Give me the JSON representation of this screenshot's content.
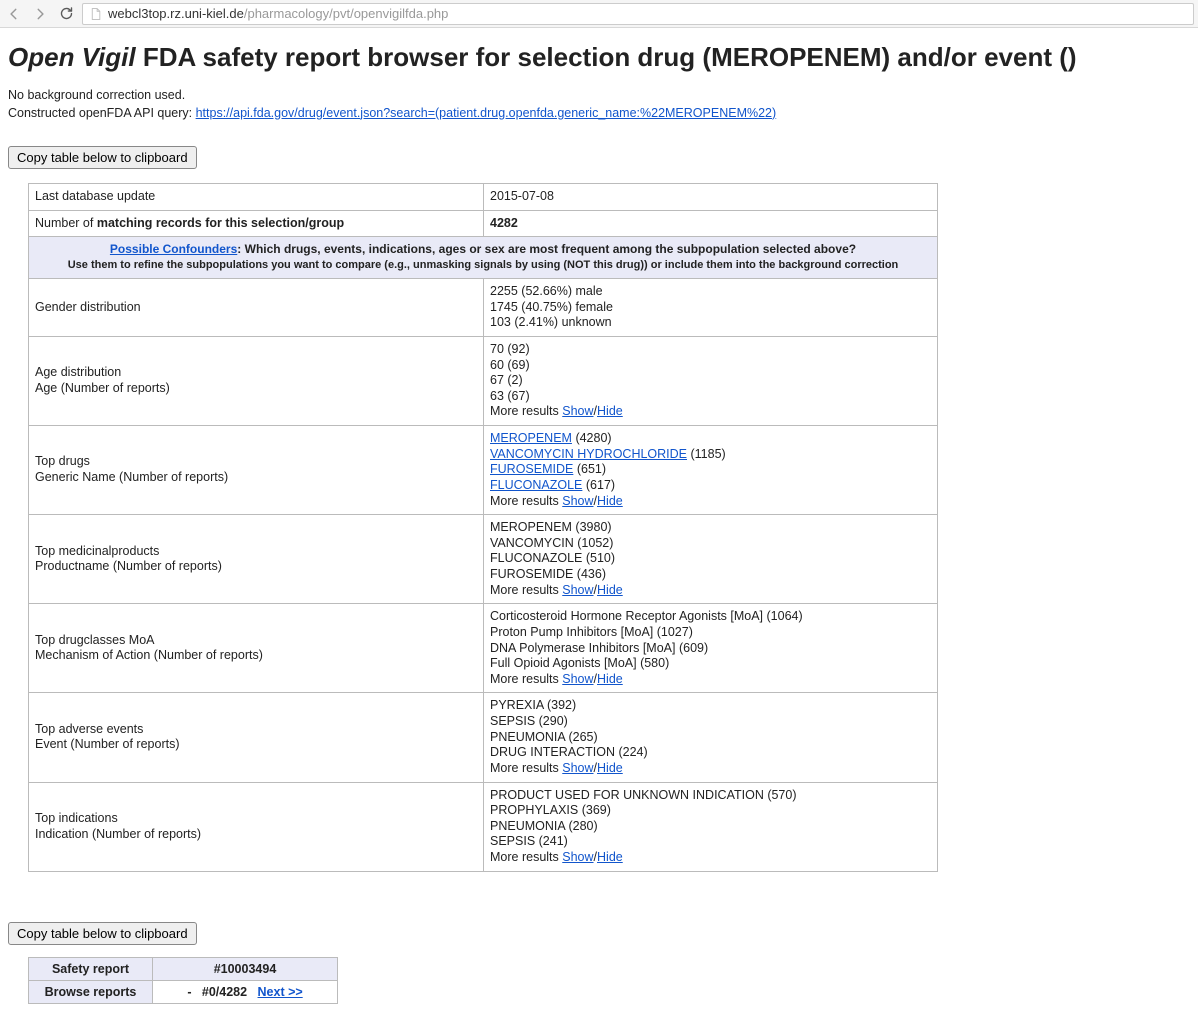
{
  "browser": {
    "url_host": "webcl3top.rz.uni-kiel.de",
    "url_path": "/pharmacology/pvt/openvigilfda.php"
  },
  "title": {
    "ov": "Open Vigil",
    "rest_prefix": " FDA safety report browser for selection drug (",
    "drug": "MEROPENEM",
    "rest_mid": ") and/or event ()",
    "full_rest": " FDA safety report browser for selection drug (MEROPENEM) and/or event ()"
  },
  "prelude": {
    "line1": "No background correction used.",
    "line2_label": "Constructed openFDA API query: ",
    "line2_url": "https://api.fda.gov/drug/event.json?search=(patient.drug.openfda.generic_name:%22MEROPENEM%22)"
  },
  "copy_btn": "Copy table below to clipboard",
  "rows": {
    "last_update_label": "Last database update",
    "last_update_value": "2015-07-08",
    "matching_label_pre": "Number of ",
    "matching_label_bold": "matching records for this selection/group",
    "matching_value": "4282",
    "confounders_link": "Possible Confounders",
    "confounders_line1": ": Which drugs, events, indications, ages or sex are most frequent among the subpopulation selected above?",
    "confounders_line2": "Use them to refine the subpopulations you want to compare (e.g., unmasking signals by using (NOT this drug)) or include them into the background correction",
    "gender_label": "Gender distribution",
    "gender_values": [
      "2255 (52.66%) male",
      "1745 (40.75%) female",
      "103 (2.41%) unknown"
    ],
    "age_label1": "Age distribution",
    "age_label2": "Age (Number of reports)",
    "age_values": [
      "70 (92)",
      "60 (69)",
      "67 (2)",
      "63 (67)"
    ],
    "topdrugs_label1": "Top drugs",
    "topdrugs_label2": "Generic Name (Number of reports)",
    "topdrugs_items": [
      {
        "name": "MEROPENEM",
        "count": "(4280)"
      },
      {
        "name": "VANCOMYCIN HYDROCHLORIDE",
        "count": "(1185)"
      },
      {
        "name": "FUROSEMIDE",
        "count": "(651)"
      },
      {
        "name": "FLUCONAZOLE",
        "count": "(617)"
      }
    ],
    "topmed_label1": "Top medicinalproducts",
    "topmed_label2": "Productname (Number of reports)",
    "topmed_values": [
      "MEROPENEM (3980)",
      "VANCOMYCIN (1052)",
      "FLUCONAZOLE (510)",
      "FUROSEMIDE (436)"
    ],
    "moa_label1": "Top drugclasses MoA",
    "moa_label2": "Mechanism of Action (Number of reports)",
    "moa_values": [
      "Corticosteroid Hormone Receptor Agonists [MoA] (1064)",
      "Proton Pump Inhibitors [MoA] (1027)",
      "DNA Polymerase Inhibitors [MoA] (609)",
      "Full Opioid Agonists [MoA] (580)"
    ],
    "events_label1": "Top adverse events",
    "events_label2": "Event (Number of reports)",
    "events_values": [
      "PYREXIA (392)",
      "SEPSIS (290)",
      "PNEUMONIA (265)",
      "DRUG INTERACTION (224)"
    ],
    "indications_label1": "Top indications",
    "indications_label2": "Indication (Number of reports)",
    "indications_values": [
      "PRODUCT USED FOR UNKNOWN INDICATION (570)",
      "PROPHYLAXIS (369)",
      "PNEUMONIA (280)",
      "SEPSIS (241)"
    ],
    "more_label": "More results ",
    "show": "Show",
    "hide": "Hide",
    "slash": "/"
  },
  "report": {
    "safety_label": "Safety report",
    "safety_value": "#10003494",
    "browse_label": "Browse reports",
    "browse_dash": "-",
    "browse_pos": "#0/4282",
    "browse_next": "Next >>"
  }
}
